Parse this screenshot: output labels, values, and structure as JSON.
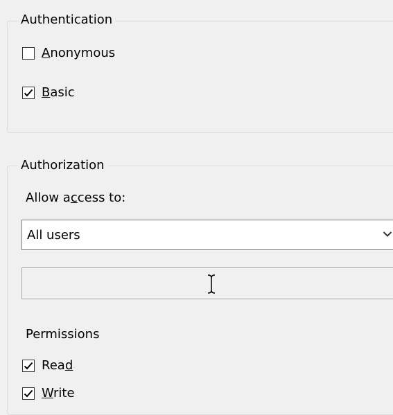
{
  "authentication": {
    "legend": "Authentication",
    "anonymous": {
      "pre": "",
      "accel": "A",
      "post": "nonymous",
      "checked": false
    },
    "basic": {
      "pre": "",
      "accel": "B",
      "post": "asic",
      "checked": true
    }
  },
  "authorization": {
    "legend": "Authorization",
    "allow_access": {
      "pre": "Allow a",
      "accel": "c",
      "post": "cess to:"
    },
    "select_value": "All users",
    "users_field_value": "",
    "permissions_label": "Permissions",
    "read": {
      "pre": "Rea",
      "accel": "d",
      "post": "",
      "checked": true
    },
    "write": {
      "pre": "",
      "accel": "W",
      "post": "rite",
      "checked": true
    }
  },
  "icons": [
    "checkmark-icon",
    "chevron-down-icon",
    "i-beam-cursor-icon"
  ]
}
